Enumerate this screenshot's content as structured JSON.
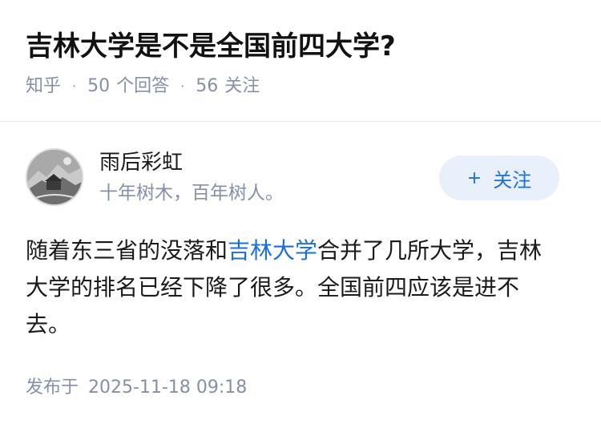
{
  "question": {
    "title": "吉林大学是不是全国前四大学?",
    "source": "知乎",
    "answers_count": "50",
    "answers_label": "个回答",
    "followers_count": "56",
    "followers_label": "关注"
  },
  "answer": {
    "author": {
      "name": "雨后彩虹",
      "bio": "十年树木，百年树人。",
      "avatar_icon": "landscape-avatar-icon"
    },
    "follow_button": {
      "plus": "+",
      "label": "关注"
    },
    "content": {
      "before_link": "随着东三省的没落和",
      "link_text": "吉林大学",
      "after_link": "合并了几所大学，吉林大学的排名已经下降了很多。全国前四应该是进不去。"
    },
    "footer": {
      "published_label": "发布于",
      "published_time": "2025-11-18 09:18"
    }
  },
  "colors": {
    "accent": "#1a6fdb",
    "muted": "#8590a6",
    "follow_bg": "#e8f1fb"
  }
}
